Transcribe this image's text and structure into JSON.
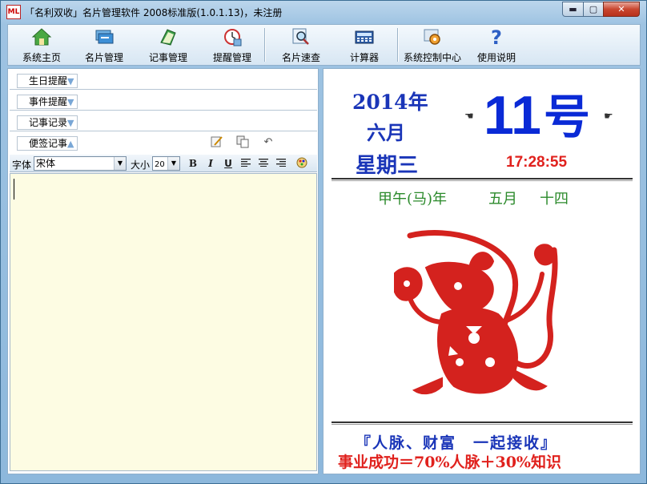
{
  "window": {
    "title": "「名利双收」名片管理软件 2008标准版(1.0.1.13)，未注册",
    "app_icon_text": "ML",
    "controls": {
      "minimize": "▬",
      "maximize": "▢",
      "close": "✕"
    }
  },
  "toolbar": {
    "items": [
      {
        "label": "系统主页",
        "icon": "home-icon"
      },
      {
        "label": "名片管理",
        "icon": "cards-icon"
      },
      {
        "label": "记事管理",
        "icon": "notebook-icon"
      },
      {
        "label": "提醒管理",
        "icon": "alarm-clock-icon"
      },
      {
        "label": "名片速查",
        "icon": "magnifier-icon"
      },
      {
        "label": "计算器",
        "icon": "calculator-icon"
      },
      {
        "label": "系统控制中心",
        "icon": "gear-icon"
      },
      {
        "label": "使用说明",
        "icon": "help-icon"
      }
    ]
  },
  "left": {
    "sections": [
      {
        "label": "生日提醒",
        "arrow": "▼"
      },
      {
        "label": "事件提醒",
        "arrow": "▼"
      },
      {
        "label": "记事记录",
        "arrow": "▼"
      },
      {
        "label": "便签记事",
        "arrow": "▲"
      }
    ],
    "format": {
      "font_label": "字体",
      "font_value": "宋体",
      "size_label": "大小",
      "size_value": "20",
      "bold": "B",
      "italic": "I",
      "underline": "U"
    }
  },
  "calendar": {
    "year": "2014年",
    "month": "六月",
    "weekday": "星期三",
    "day": "11",
    "day_suffix": "号",
    "time": "17:28:55",
    "lunar_year": "甲午(马)年",
    "lunar_month": "五月",
    "lunar_day": "十四",
    "slogan_line1": "『人脉、财富　一起接收』",
    "slogan_line2": "事业成功＝70%人脉＋30%知识"
  },
  "colors": {
    "accent_blue": "#1a35b8",
    "day_blue": "#0a2ad6",
    "clock_red": "#e0211d",
    "lunar_green": "#2b8a2b",
    "papercut_red": "#d4221e",
    "editor_bg": "#fdfce3"
  }
}
